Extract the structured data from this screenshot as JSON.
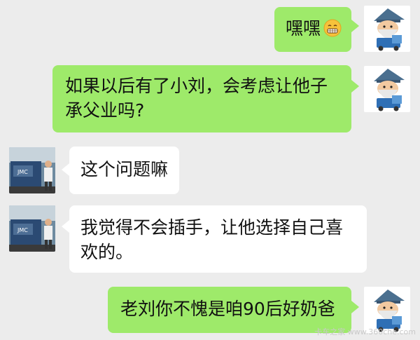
{
  "messages": [
    {
      "side": "right",
      "text": "嘿嘿",
      "emoji": "grin-emoji"
    },
    {
      "side": "right",
      "text": "如果以后有了小刘，会考虑让他子承父业吗?"
    },
    {
      "side": "left",
      "text": "这个问题嘛"
    },
    {
      "side": "left",
      "text": "我觉得不会插手，让他选择自己喜欢的。"
    },
    {
      "side": "right",
      "text": "老刘你不愧是咱90后好奶爸"
    }
  ],
  "watermark": "卡车之家 www.360che.com",
  "colors": {
    "background": "#ececec",
    "self_bubble": "#9eea6a",
    "other_bubble": "#ffffff"
  },
  "icons": {
    "self_avatar": "cartoon-old-man-truck-avatar",
    "other_avatar": "man-with-truck-photo-avatar"
  }
}
